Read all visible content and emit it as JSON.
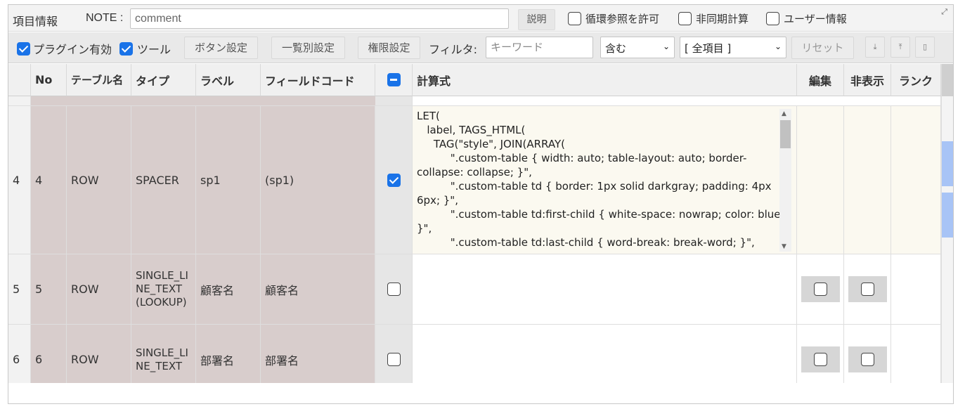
{
  "header": {
    "title": "項目情報",
    "note_label": "NOTE :",
    "note_value": "comment",
    "explain_button": "説明",
    "allow_circular": {
      "label": "循環参照を許可",
      "checked": false
    },
    "async_calc": {
      "label": "非同期計算",
      "checked": false
    },
    "user_info": {
      "label": "ユーザー情報",
      "checked": false
    },
    "expand_icon": "expand-icon"
  },
  "toolbar": {
    "plugin_enabled": {
      "label": "プラグイン有効",
      "checked": true
    },
    "tools": {
      "label": "ツール",
      "checked": true
    },
    "button_settings": "ボタン設定",
    "list_settings": "一覧別設定",
    "permission_settings": "権限設定",
    "filter_label": "フィルタ:",
    "keyword_placeholder": "キーワード",
    "match_select": "含む",
    "scope_select": "[ 全項目 ]",
    "reset_button": "リセット",
    "icons": [
      "download-icon",
      "upload-icon",
      "clipboard-icon"
    ]
  },
  "table": {
    "columns": {
      "no": "No",
      "table_name": "テーブル名",
      "type": "タイプ",
      "label": "ラベル",
      "field_code": "フィールドコード",
      "formula": "計算式",
      "edit": "編集",
      "hidden": "非表示",
      "rank": "ランク"
    },
    "rows": [
      {
        "index": "4",
        "no": "4",
        "table_name": "ROW",
        "type": "SPACER",
        "label": "sp1",
        "field_code": "(sp1)",
        "calc_checked": true,
        "formula": "LET(\n   label, TAGS_HTML(\n     TAG(\"style\", JOIN(ARRAY(\n          \".custom-table { width: auto; table-layout: auto; border-collapse: collapse; }\",\n          \".custom-table td { border: 1px solid darkgray; padding: 4px 6px; }\",\n          \".custom-table td:first-child { white-space: nowrap; color: blue; }\",\n          \".custom-table td:last-child { word-break: break-word; }\","
      },
      {
        "index": "5",
        "no": "5",
        "table_name": "ROW",
        "type": "SINGLE_LINE_TEXT (LOOKUP)",
        "label": "顧客名",
        "field_code": "顧客名",
        "calc_checked": false,
        "formula": ""
      },
      {
        "index": "6",
        "no": "6",
        "table_name": "ROW",
        "type": "SINGLE_LINE_TEXT",
        "label": "部署名",
        "field_code": "部署名",
        "calc_checked": false,
        "formula": ""
      }
    ]
  }
}
